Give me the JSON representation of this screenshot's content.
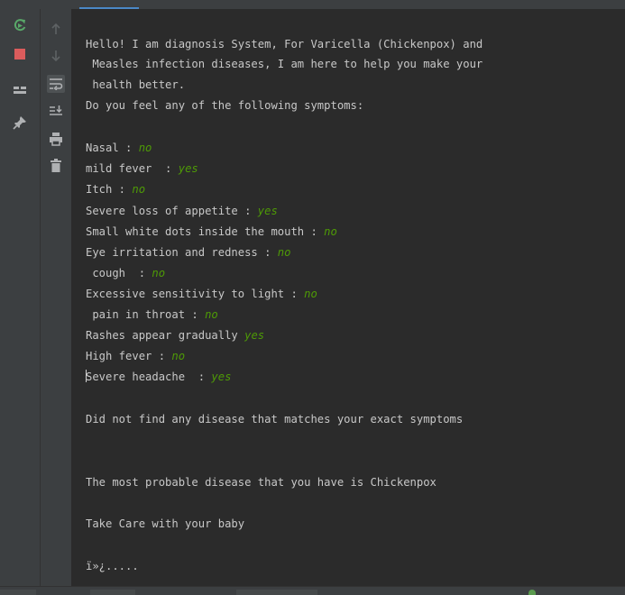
{
  "console": {
    "intro": {
      "line1": "Hello! I am diagnosis System, For Varicella (Chickenpox) and",
      "line2": " Measles infection diseases, I am here to help you make your",
      "line3": " health better.",
      "line4": "Do you feel any of the following symptoms:"
    },
    "symptoms": [
      {
        "question": "Nasal : ",
        "answer": "no"
      },
      {
        "question": "mild fever  : ",
        "answer": "yes"
      },
      {
        "question": "Itch : ",
        "answer": "no"
      },
      {
        "question": "Severe loss of appetite : ",
        "answer": "yes"
      },
      {
        "question": "Small white dots inside the mouth : ",
        "answer": "no"
      },
      {
        "question": "Eye irritation and redness : ",
        "answer": "no"
      },
      {
        "question": " cough  : ",
        "answer": "no"
      },
      {
        "question": "Excessive sensitivity to light : ",
        "answer": "no"
      },
      {
        "question": " pain in throat : ",
        "answer": "no"
      },
      {
        "question": "Rashes appear gradually ",
        "answer": "yes"
      },
      {
        "question": "High fever : ",
        "answer": "no"
      },
      {
        "question": "Severe headache  : ",
        "answer": "yes"
      }
    ],
    "result_no_match": "Did not find any disease that matches your exact symptoms",
    "result_probable": "The most probable disease that you have is Chickenpox",
    "closing": "Take Care with your baby",
    "trailing": "ï»¿....."
  },
  "toolbar": {
    "left_icons": [
      "rerun-icon",
      "stop-icon",
      "layout-icon",
      "pin-icon"
    ],
    "right_icons": [
      "up-arrow-icon",
      "down-arrow-icon",
      "soft-wrap-icon",
      "scroll-to-end-icon",
      "print-icon",
      "trash-icon"
    ]
  },
  "colors": {
    "background": "#2b2b2b",
    "toolbar": "#3c3f41",
    "text": "#c8c8c8",
    "user_input": "#4e9a06",
    "rerun": "#59a869",
    "stop": "#db5c5c",
    "accent": "#4a88c7"
  }
}
